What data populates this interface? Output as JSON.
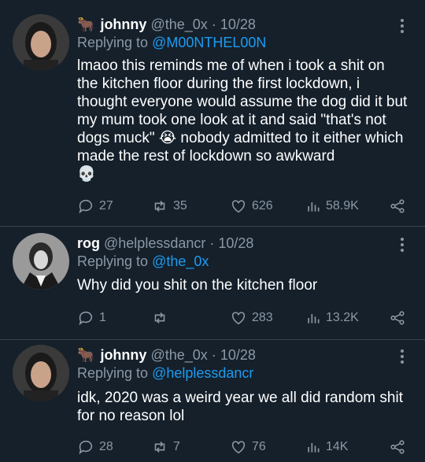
{
  "tweets": [
    {
      "emoji": "🐂",
      "name": "johnny",
      "handle": "@the_0x",
      "dot": "·",
      "date": "10/28",
      "reply_prefix": "Replying to",
      "reply_to": "@M00NTHEL00N",
      "text": "lmaoo this reminds me of when i took a shit on the kitchen floor during the first lockdown, i thought everyone would assume the dog did it but my mum took one look at it and said \"that's not dogs muck\" 😭 nobody admitted to it either which made the rest of lockdown so awkward",
      "trailing_emoji": "💀",
      "replies": "27",
      "retweets": "35",
      "likes": "626",
      "views": "58.9K"
    },
    {
      "emoji": "",
      "name": "rog",
      "handle": "@helplessdancr",
      "dot": "·",
      "date": "10/28",
      "reply_prefix": "Replying to",
      "reply_to": "@the_0x",
      "text": "Why did you shit on the kitchen floor",
      "trailing_emoji": "",
      "replies": "1",
      "retweets": "",
      "likes": "283",
      "views": "13.2K"
    },
    {
      "emoji": "🐂",
      "name": "johnny",
      "handle": "@the_0x",
      "dot": "·",
      "date": "10/28",
      "reply_prefix": "Replying to",
      "reply_to": "@helplessdancr",
      "text": "idk, 2020 was a weird year we all did random shit for no reason lol",
      "trailing_emoji": "",
      "replies": "28",
      "retweets": "7",
      "likes": "76",
      "views": "14K"
    }
  ],
  "colors": {
    "background": "#15202b",
    "secondary_text": "#8b98a5",
    "mention": "#1d9bf0",
    "divider": "#38444d"
  },
  "icons": [
    "reply-icon",
    "retweet-icon",
    "like-icon",
    "views-icon",
    "share-icon",
    "more-options-icon"
  ]
}
